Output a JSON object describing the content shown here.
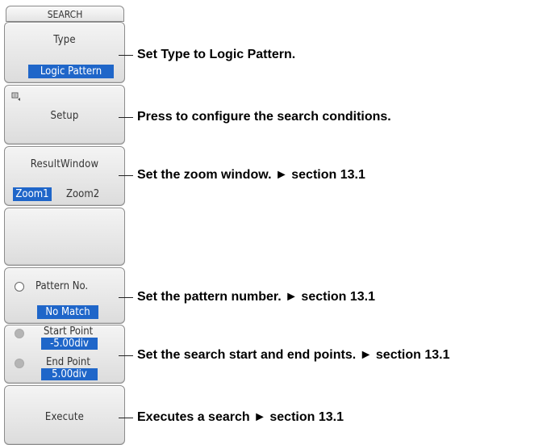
{
  "menu": {
    "title": "SEARCH",
    "type": {
      "label": "Type",
      "value": "Logic Pattern"
    },
    "setup": {
      "label": "Setup",
      "icon": "setup-menu-icon"
    },
    "result_window": {
      "label": "ResultWindow",
      "options": [
        "Zoom1",
        "Zoom2"
      ],
      "selected": "Zoom1"
    },
    "pattern_no": {
      "label": "Pattern No.",
      "value": "No Match",
      "icon": "jog-knob-icon"
    },
    "start_point": {
      "label": "Start Point",
      "value": "-5.00div"
    },
    "end_point": {
      "label": "End Point",
      "value": "5.00div"
    },
    "execute": {
      "label": "Execute"
    }
  },
  "annotations": {
    "type": "Set Type to Logic Pattern.",
    "setup": "Press to configure the search conditions.",
    "result_window": "Set the zoom window. ► section 13.1",
    "pattern_no": "Set the pattern number. ► section 13.1",
    "points": "Set the search start and end points. ► section 13.1",
    "execute": "Executes a search ► section 13.1"
  }
}
